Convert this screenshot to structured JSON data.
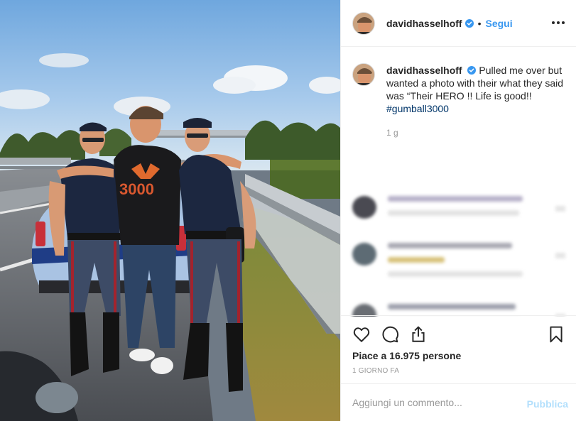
{
  "post": {
    "username": "davidhasselhoff",
    "follow_label": "Segui",
    "dot": "•",
    "more_icon": "more-options-icon",
    "verified_color": "#3897f0",
    "caption_text": "Pulled me over but wanted a photo with their what they said was “Their HERO !! Life is good!!",
    "hashtag": "#gumball3000",
    "caption_age": "1 g",
    "likes_text": "Piace a 16.975 persone",
    "timestamp": "1 GIORNO FA",
    "comment_placeholder": "Aggiungi un commento...",
    "publish_label": "Pubblica",
    "shirt_text": "3000",
    "icons": [
      "heart-icon",
      "comment-icon",
      "share-icon",
      "bookmark-icon"
    ]
  }
}
